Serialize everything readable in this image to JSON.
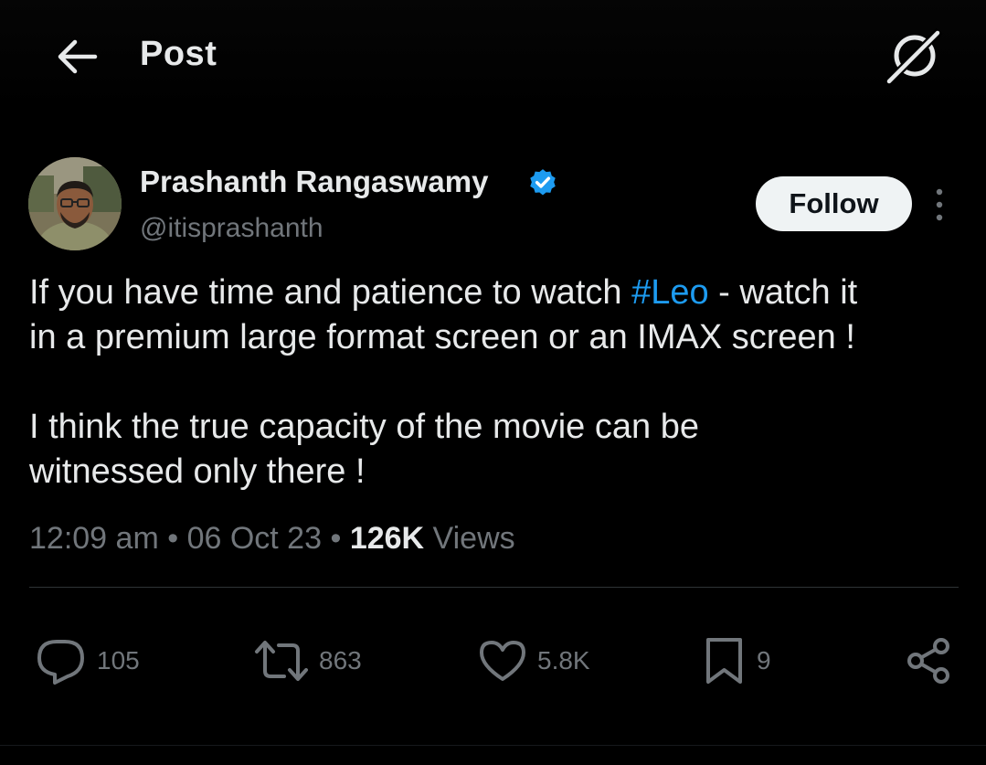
{
  "header": {
    "title": "Post",
    "back_icon": "arrow-left-icon",
    "grok_icon": "grok-icon"
  },
  "author": {
    "name": "Prashanth Rangaswamy",
    "handle": "@itisprashanth",
    "verified": true,
    "verified_color": "#1d9bf0"
  },
  "follow_label": "Follow",
  "post": {
    "line1_pre": "If you have time and patience to watch ",
    "hashtag": "#Leo",
    "line1_post": " - watch it",
    "line2": "in a premium large format screen or an IMAX screen !",
    "line3": "I think the true capacity of the movie can be",
    "line4": "witnessed only there !"
  },
  "meta": {
    "time": "12:09 am",
    "sep": "•",
    "date": "06 Oct 23",
    "views_count": "126K",
    "views_label": "Views"
  },
  "actions": {
    "replies": "105",
    "reposts": "863",
    "likes": "5.8K",
    "bookmarks": "9"
  },
  "colors": {
    "background": "#000000",
    "text": "#e7e9ea",
    "muted": "#71767b",
    "accent": "#1d9bf0"
  }
}
